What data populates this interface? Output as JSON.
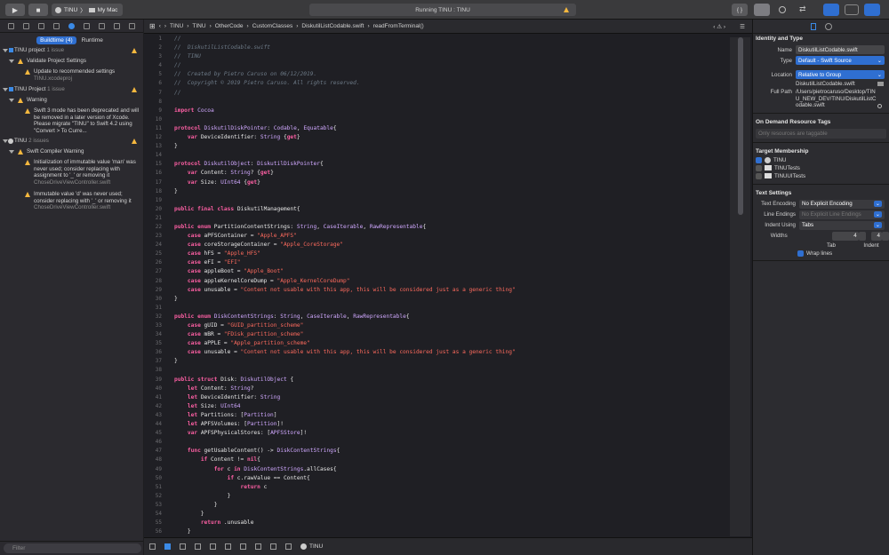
{
  "toolbar": {
    "scheme_name": "TINU",
    "scheme_sep": "〉",
    "device_name": "My Mac",
    "status": "Running TINU : TINU",
    "code_review": "{ }"
  },
  "navigator": {
    "segments": [
      "Buildtime (4)",
      "Runtime"
    ],
    "filter_placeholder": "Filter",
    "groups": [
      {
        "title": "TINU project",
        "count": "1 issue"
      },
      {
        "title": "Validate Project Settings"
      },
      {
        "title": "Update to recommended settings",
        "sub": "TINU.xcodeproj"
      },
      {
        "title": "TINU Project",
        "count": "1 issue"
      },
      {
        "title": "Warning"
      },
      {
        "title": "Swift 3 mode has been deprecated and will be removed in a later version of Xcode. Please migrate \"TINU\" to Swift 4.2 using \"Convert > To Curre..."
      },
      {
        "title": "TINU",
        "count": "2 issues"
      },
      {
        "title": "Swift Compiler Warning"
      },
      {
        "title": "Initialization of immutable value 'man' was never used; consider replacing with assignment to '_' or removing it",
        "sub": "ChoseDriveViewController.swift"
      },
      {
        "title": "Immutable value 'd' was never used; consider replacing with '_' or removing it",
        "sub": "ChoseDriveViewController.swift"
      }
    ]
  },
  "jumpbar": [
    "TINU",
    "TINU",
    "OtherCode",
    "CustomClasses",
    "DiskutilListCodable.swift",
    "readFromTerminal()"
  ],
  "code_lines": [
    "//",
    "//  DiskutilListCodable.swift",
    "//  TINU",
    "//",
    "//  Created by Pietro Caruso on 06/12/2019.",
    "//  Copyright © 2019 Pietro Caruso. All rights reserved.",
    "//",
    "",
    "import Cocoa",
    "",
    "protocol DiskutilDiskPointer: Codable, Equatable{",
    "    var DeviceIdentifier: String {get}",
    "}",
    "",
    "protocol DiskutilObject: DiskutilDiskPointer{",
    "    var Content: String? {get}",
    "    var Size: UInt64 {get}",
    "}",
    "",
    "public final class DiskutilManagement{",
    "",
    "public enum PartitionContentStrings: String, CaseIterable, RawRepresentable{",
    "    case aPFSContainer = \"Apple_APFS\"",
    "    case coreStorageContainer = \"Apple_CoreStorage\"",
    "    case hFS = \"Apple_HFS\"",
    "    case eFI = \"EFI\"",
    "    case appleBoot = \"Apple_Boot\"",
    "    case appleKernelCoreDump = \"Apple_KernelCoreDump\"",
    "    case unusable = \"Content not usable with this app, this will be considered just as a generic thing\"",
    "}",
    "",
    "public enum DiskContentStrings: String, CaseIterable, RawRepresentable{",
    "    case gUID = \"GUID_partition_scheme\"",
    "    case mBR = \"FDisk_partition_scheme\"",
    "    case aPPLE = \"Apple_partition_scheme\"",
    "    case unusable = \"Content not usable with this app, this will be considered just as a generic thing\"",
    "}",
    "",
    "public struct Disk: DiskutilObject {",
    "    let Content: String?",
    "    let DeviceIdentifier: String",
    "    let Size: UInt64",
    "    let Partitions: [Partition]",
    "    let APFSVolumes: [Partition]!",
    "    var APFSPhysicalStores: [APFSStore]!",
    "",
    "    func getUsableContent() -> DiskContentStrings{",
    "        if Content != nil{",
    "            for c in DiskContentStrings.allCases{",
    "                if c.rawValue == Content{",
    "                    return c",
    "                }",
    "            }",
    "        }",
    "        return .unusable",
    "    }"
  ],
  "inspector": {
    "identity_title": "Identity and Type",
    "name_label": "Name",
    "name_value": "DiskutilListCodable.swift",
    "type_label": "Type",
    "type_value": "Default - Swift Source",
    "location_label": "Location",
    "location_value": "Relative to Group",
    "location_file": "DiskutilListCodable.swift",
    "fullpath_label": "Full Path",
    "fullpath_value": "/Users/pietrocaruso/Desktop/TINU_NEW_DEV/TINU/DiskutilListCodable.swift",
    "odr_title": "On Demand Resource Tags",
    "odr_placeholder": "Only resources are taggable",
    "target_title": "Target Membership",
    "targets": [
      "TINU",
      "TINUTests",
      "TINUUITests"
    ],
    "text_title": "Text Settings",
    "encoding_label": "Text Encoding",
    "encoding_value": "No Explicit Encoding",
    "endings_label": "Line Endings",
    "endings_value": "No Explicit Line Endings",
    "indent_label": "Indent Using",
    "indent_value": "Tabs",
    "widths_label": "Widths",
    "tab_width": "4",
    "indent_width": "4",
    "tab_caption": "Tab",
    "indent_caption": "Indent",
    "wrap_label": "Wrap lines"
  },
  "debugbar": {
    "target": "TINU"
  }
}
